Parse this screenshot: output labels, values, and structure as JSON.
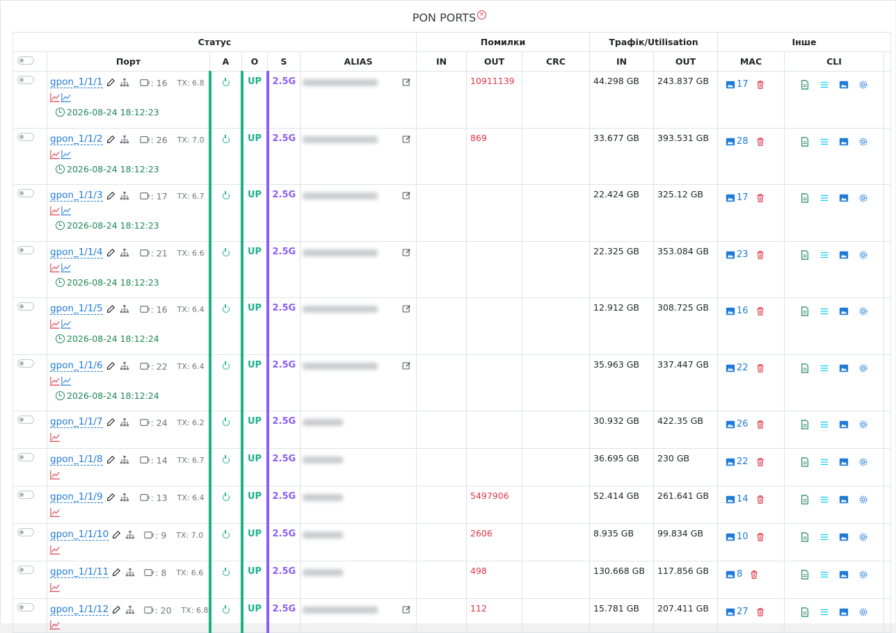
{
  "title": "PON PORTS",
  "group_headers": {
    "status": "Статус",
    "errors": "Помилки",
    "traffic": "Трафік/Utilisation",
    "other": "Інше"
  },
  "columns": {
    "port": "Порт",
    "a": "A",
    "o": "O",
    "s": "S",
    "alias": "ALIAS",
    "err_in": "IN",
    "err_out": "OUT",
    "crc": "CRC",
    "traf_in": "IN",
    "traf_out": "OUT",
    "mac": "MAC",
    "cli": "CLI"
  },
  "colors": {
    "up_green": "#1cb089",
    "speed_purple": "#8b5cf6",
    "link_blue": "#1e7ad6",
    "error_red": "#dc3545",
    "date_green": "#198754"
  },
  "rows": [
    {
      "port": "gpon_1/1/1",
      "onu_label": ": 16",
      "tx": "TX: 6.8",
      "date": "2026-08-24 18:12:23",
      "status": "UP",
      "speed": "2.5G",
      "err_in": "",
      "err_out": "10911139",
      "crc": "",
      "traf_in": "44.298 GB",
      "traf_out": "243.837 GB",
      "mac": "17"
    },
    {
      "port": "gpon_1/1/2",
      "onu_label": ": 26",
      "tx": "TX: 7.0",
      "date": "2026-08-24 18:12:23",
      "status": "UP",
      "speed": "2.5G",
      "err_in": "",
      "err_out": "869",
      "crc": "",
      "traf_in": "33.677 GB",
      "traf_out": "393.531 GB",
      "mac": "28"
    },
    {
      "port": "gpon_1/1/3",
      "onu_label": ": 17",
      "tx": "TX: 6.7",
      "date": "2026-08-24 18:12:23",
      "status": "UP",
      "speed": "2.5G",
      "err_in": "",
      "err_out": "",
      "crc": "",
      "traf_in": "22.424 GB",
      "traf_out": "325.12 GB",
      "mac": "17"
    },
    {
      "port": "gpon_1/1/4",
      "onu_label": ": 21",
      "tx": "TX: 6.6",
      "date": "2026-08-24 18:12:23",
      "status": "UP",
      "speed": "2.5G",
      "err_in": "",
      "err_out": "",
      "crc": "",
      "traf_in": "22.325 GB",
      "traf_out": "353.084 GB",
      "mac": "23"
    },
    {
      "port": "gpon_1/1/5",
      "onu_label": ": 16",
      "tx": "TX: 6.4",
      "date": "2026-08-24 18:12:24",
      "status": "UP",
      "speed": "2.5G",
      "err_in": "",
      "err_out": "",
      "crc": "",
      "traf_in": "12.912 GB",
      "traf_out": "308.725 GB",
      "mac": "16"
    },
    {
      "port": "gpon_1/1/6",
      "onu_label": ": 22",
      "tx": "TX: 6.4",
      "date": "2026-08-24 18:12:24",
      "status": "UP",
      "speed": "2.5G",
      "err_in": "",
      "err_out": "",
      "crc": "",
      "traf_in": "35.963 GB",
      "traf_out": "337.447 GB",
      "mac": "22"
    },
    {
      "port": "gpon_1/1/7",
      "onu_label": ": 24",
      "tx": "TX: 6.2",
      "date": "",
      "status": "UP",
      "speed": "2.5G",
      "err_in": "",
      "err_out": "",
      "crc": "",
      "traf_in": "30.932 GB",
      "traf_out": "422.35 GB",
      "mac": "26"
    },
    {
      "port": "gpon_1/1/8",
      "onu_label": ": 14",
      "tx": "TX: 6.7",
      "date": "",
      "status": "UP",
      "speed": "2.5G",
      "err_in": "",
      "err_out": "",
      "crc": "",
      "traf_in": "36.695 GB",
      "traf_out": "230 GB",
      "mac": "22"
    },
    {
      "port": "gpon_1/1/9",
      "onu_label": ": 13",
      "tx": "TX: 6.4",
      "date": "",
      "status": "UP",
      "speed": "2.5G",
      "err_in": "",
      "err_out": "5497906",
      "crc": "",
      "traf_in": "52.414 GB",
      "traf_out": "261.641 GB",
      "mac": "14"
    },
    {
      "port": "gpon_1/1/10",
      "onu_label": ": 9",
      "tx": "TX: 7.0",
      "date": "",
      "status": "UP",
      "speed": "2.5G",
      "err_in": "",
      "err_out": "2606",
      "crc": "",
      "traf_in": "8.935 GB",
      "traf_out": "99.834 GB",
      "mac": "10"
    },
    {
      "port": "gpon_1/1/11",
      "onu_label": ": 8",
      "tx": "TX: 6.6",
      "date": "",
      "status": "UP",
      "speed": "2.5G",
      "err_in": "",
      "err_out": "498",
      "crc": "",
      "traf_in": "130.668 GB",
      "traf_out": "117.856 GB",
      "mac": "8"
    },
    {
      "port": "gpon_1/1/12",
      "onu_label": ": 20",
      "tx": "TX: 6.8",
      "date": "",
      "status": "UP",
      "speed": "2.5G",
      "err_in": "",
      "err_out": "112",
      "crc": "",
      "traf_in": "15.781 GB",
      "traf_out": "207.411 GB",
      "mac": "27"
    }
  ]
}
